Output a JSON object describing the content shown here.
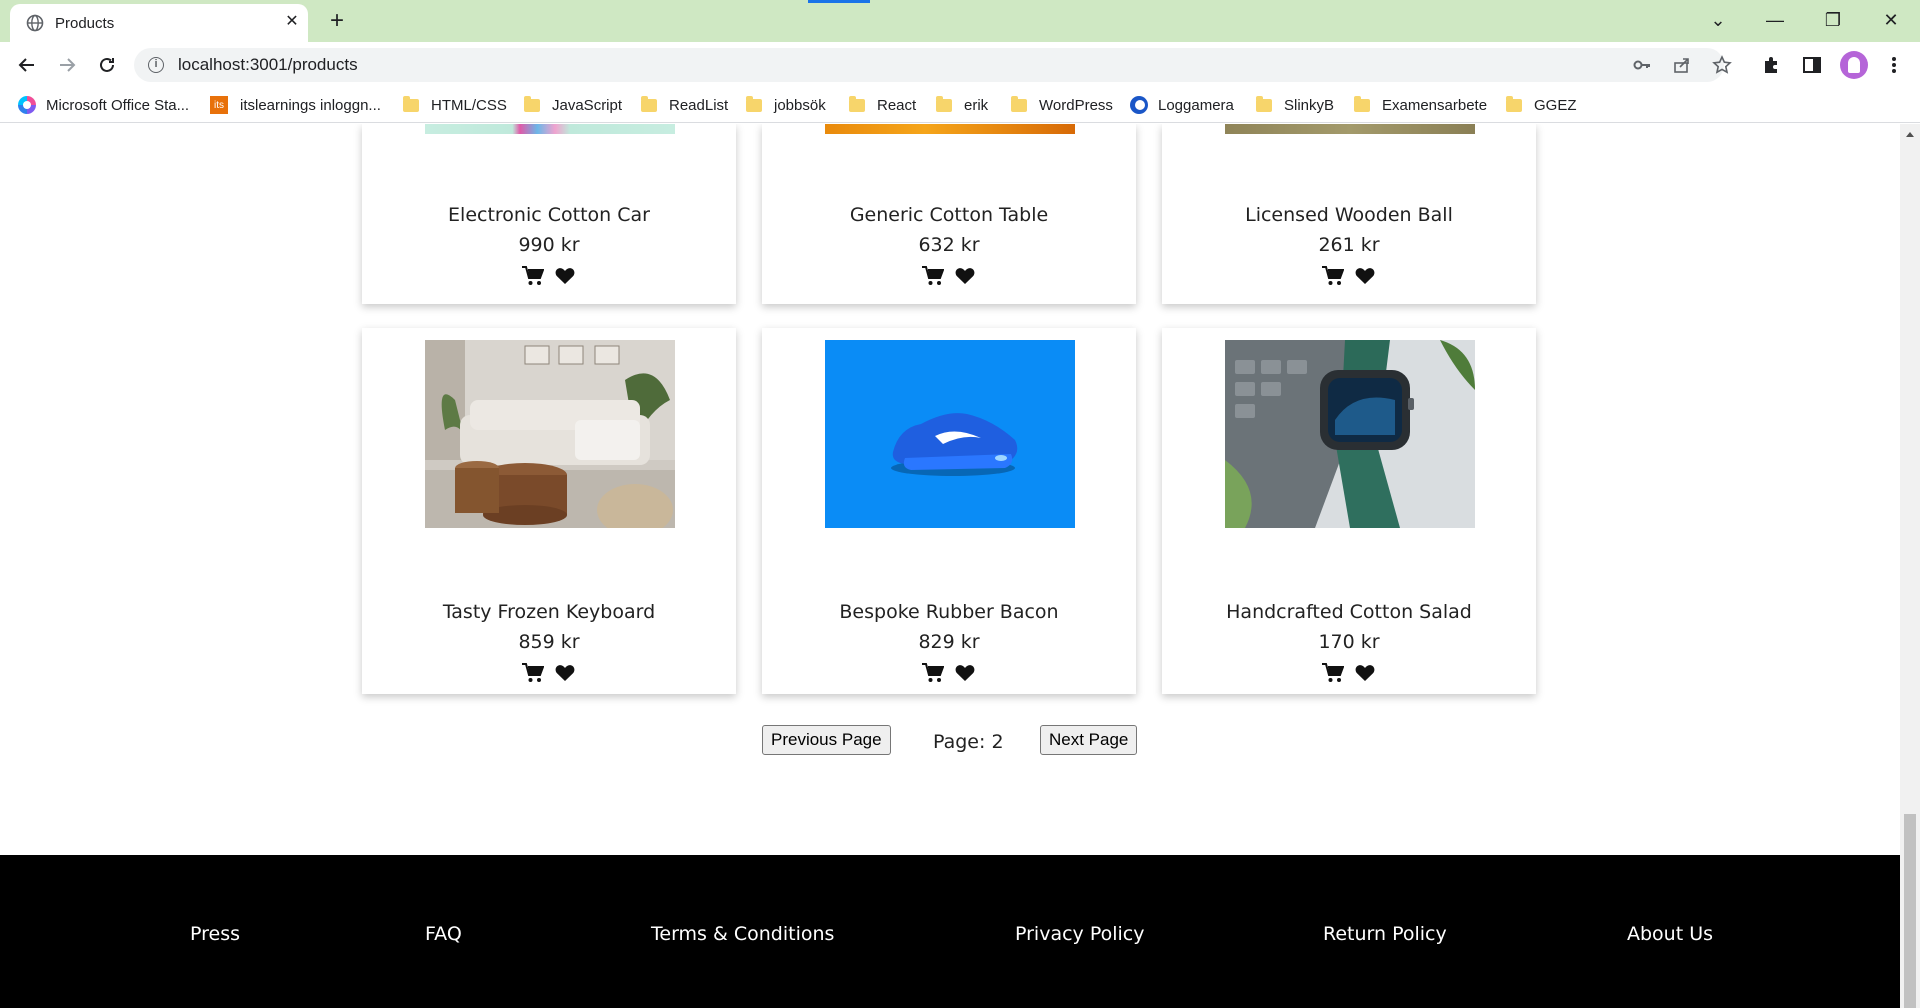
{
  "browser": {
    "tab_title": "Products",
    "tab_close": "✕",
    "new_tab": "+",
    "url": "localhost:3001/products",
    "window_controls": [
      "⌄",
      "—",
      "❐",
      "✕"
    ]
  },
  "bookmarks": [
    {
      "label": "Microsoft Office Sta...",
      "icon": "microsoft-office-icon"
    },
    {
      "label": "itslearnings inloggn...",
      "icon": "its-icon",
      "icon_text": "its"
    },
    {
      "label": "HTML/CSS",
      "icon": "folder-icon"
    },
    {
      "label": "JavaScript",
      "icon": "folder-icon"
    },
    {
      "label": "ReadList",
      "icon": "folder-icon"
    },
    {
      "label": "jobbsök",
      "icon": "folder-icon"
    },
    {
      "label": "React",
      "icon": "folder-icon"
    },
    {
      "label": "erik",
      "icon": "folder-icon"
    },
    {
      "label": "WordPress",
      "icon": "folder-icon"
    },
    {
      "label": "Loggamera",
      "icon": "loggamera-icon"
    },
    {
      "label": "SlinkyB",
      "icon": "folder-icon"
    },
    {
      "label": "Examensarbete",
      "icon": "folder-icon"
    },
    {
      "label": "GGEZ",
      "icon": "folder-icon"
    }
  ],
  "products": [
    {
      "name": "Electronic Cotton Car",
      "price": "990 kr",
      "image": "colorful-pattern"
    },
    {
      "name": "Generic Cotton Table",
      "price": "632 kr",
      "image": "orange-gradient"
    },
    {
      "name": "Licensed Wooden Ball",
      "price": "261 kr",
      "image": "olive-texture"
    },
    {
      "name": "Tasty Frozen Keyboard",
      "price": "859 kr",
      "image": "living-room-sofa"
    },
    {
      "name": "Bespoke Rubber Bacon",
      "price": "829 kr",
      "image": "blue-sneaker"
    },
    {
      "name": "Handcrafted Cotton Salad",
      "price": "170 kr",
      "image": "smartwatch"
    }
  ],
  "pagination": {
    "prev_label": "Previous Page",
    "page_label": "Page: 2",
    "next_label": "Next Page"
  },
  "footer": {
    "links": [
      "Press",
      "FAQ",
      "Terms & Conditions",
      "Privacy Policy",
      "Return Policy",
      "About Us"
    ]
  },
  "colors": {
    "tabbar": "#cfe8c3",
    "footer": "#000000",
    "accent": "#1a73e8"
  }
}
